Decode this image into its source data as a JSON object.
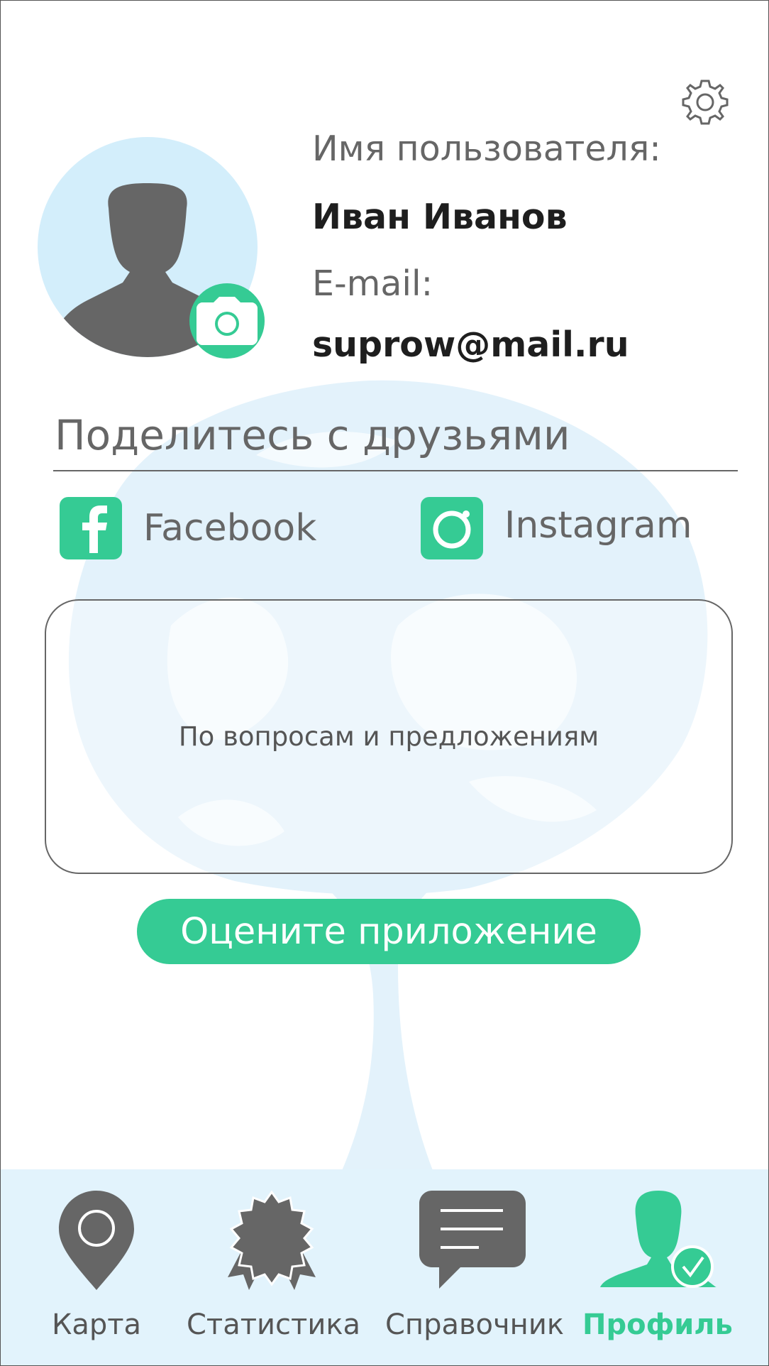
{
  "profile": {
    "username_label": "Имя пользователя:",
    "username": "Иван Иванов",
    "email_label": "E-mail:",
    "email": "suprow@mail.ru"
  },
  "share": {
    "title": "Поделитесь с друзьями",
    "facebook": "Facebook",
    "instagram": "Instagram"
  },
  "feedback": {
    "placeholder": "По вопросам и предложениям"
  },
  "rate_button": "Оцените приложение",
  "nav": {
    "items": [
      {
        "label": "Карта",
        "icon": "map-pin-icon"
      },
      {
        "label": "Статистика",
        "icon": "award-badge-icon"
      },
      {
        "label": "Справочник",
        "icon": "chat-bubble-icon"
      },
      {
        "label": "Профиль",
        "icon": "profile-check-icon",
        "active": true
      }
    ]
  },
  "colors": {
    "accent": "#35cb94",
    "avatar_bg": "#d3eefb",
    "nav_bg": "#e2f3fc",
    "icon_gray": "#666666",
    "watermark": "#e3f2fb"
  }
}
